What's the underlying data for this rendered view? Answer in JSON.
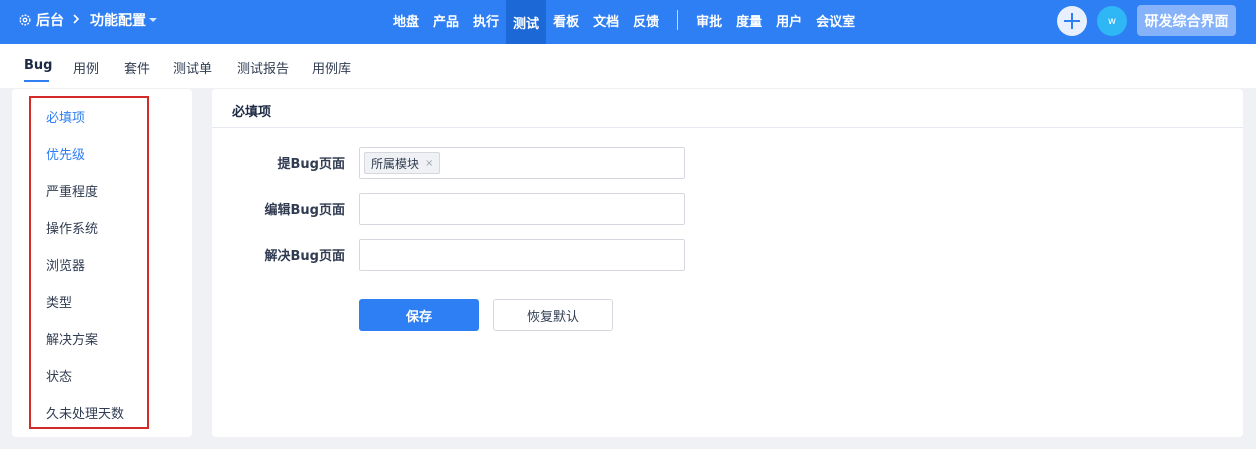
{
  "topbar": {
    "brand_label": "后台",
    "crumb_label": "功能配置",
    "nav": [
      "地盘",
      "产品",
      "执行",
      "测试",
      "看板",
      "文档",
      "反馈"
    ],
    "nav_active_index": 3,
    "nav_right": [
      "审批",
      "度量",
      "用户",
      "会议室"
    ],
    "avatar_letter": "w",
    "workspace_label": "研发综合界面",
    "bar_color": "#2e7ff4",
    "active_color": "#1c68d6"
  },
  "subnav": {
    "items": [
      "Bug",
      "用例",
      "套件",
      "测试单",
      "测试报告",
      "用例库"
    ],
    "active_index": 0
  },
  "sidebar": {
    "items": [
      "必填项",
      "优先级",
      "严重程度",
      "操作系统",
      "浏览器",
      "类型",
      "解决方案",
      "状态",
      "久未处理天数"
    ],
    "active_items": [
      0,
      1
    ],
    "outline_color": "#d42a2a"
  },
  "panel": {
    "title": "必填项",
    "fields": [
      {
        "label": "提Bug页面",
        "tags": [
          "所属模块"
        ]
      },
      {
        "label": "编辑Bug页面",
        "tags": []
      },
      {
        "label": "解决Bug页面",
        "tags": []
      }
    ],
    "tag_remove_glyph": "×",
    "save_label": "保存",
    "reset_label": "恢复默认"
  },
  "icons": {
    "brand": "gear-icon",
    "crumb_separator": "chevron-right-icon",
    "crumb_caret": "caret-down-icon",
    "create": "plus-icon",
    "tag_remove": "close-icon"
  }
}
